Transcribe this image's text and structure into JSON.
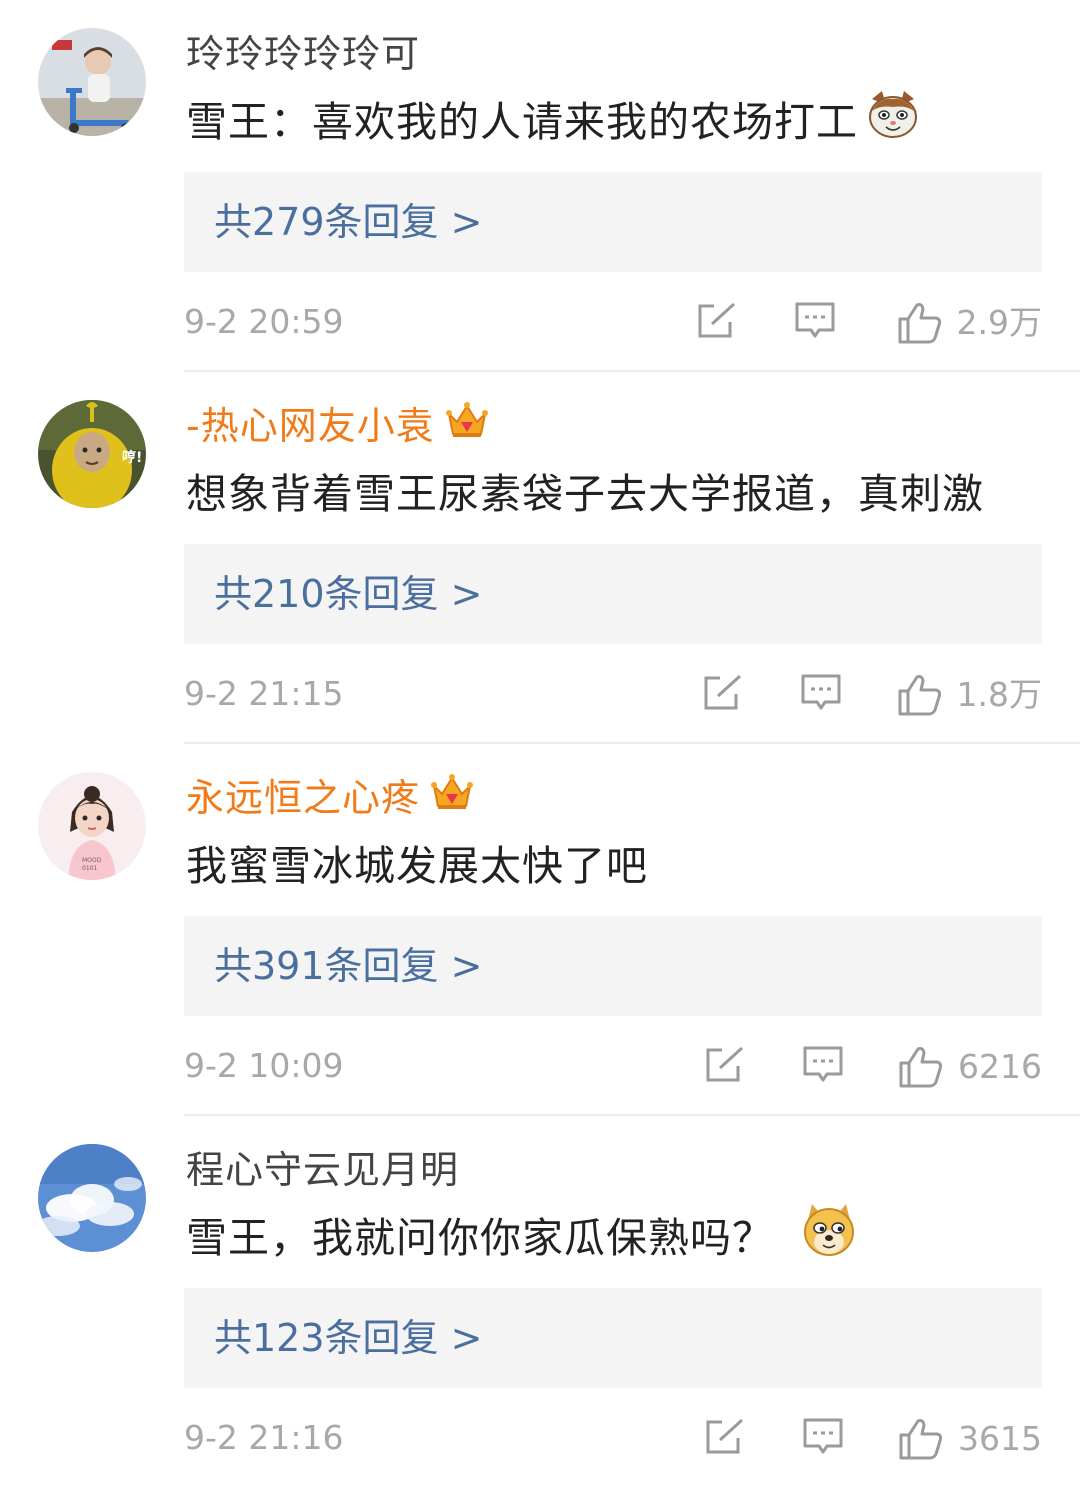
{
  "colors": {
    "vip_name": "#f07b18",
    "reply_link": "#4a6f9e",
    "meta_gray": "#a8a8a8"
  },
  "comments": [
    {
      "username": "玲玲玲玲玲可",
      "vip": false,
      "text": "雪王：喜欢我的人请来我的农场打工",
      "emoji": "cat-face-emoji",
      "replies_label": "共279条回复 >",
      "time": "9-2 20:59",
      "likes": "2.9万"
    },
    {
      "username": "-热心网友小袁",
      "vip": true,
      "text": "想象背着雪王尿素袋子去大学报道，真刺激",
      "emoji": "",
      "replies_label": "共210条回复 >",
      "time": "9-2 21:15",
      "likes": "1.8万"
    },
    {
      "username": "永远恒之心疼",
      "vip": true,
      "text": "我蜜雪冰城发展太快了吧",
      "emoji": "",
      "replies_label": "共391条回复 >",
      "time": "9-2 10:09",
      "likes": "6216"
    },
    {
      "username": "程心守云见月明",
      "vip": false,
      "text": "雪王，我就问你你家瓜保熟吗？",
      "emoji": "doge-emoji",
      "replies_label": "共123条回复 >",
      "time": "9-2 21:16",
      "likes": "3615"
    }
  ]
}
